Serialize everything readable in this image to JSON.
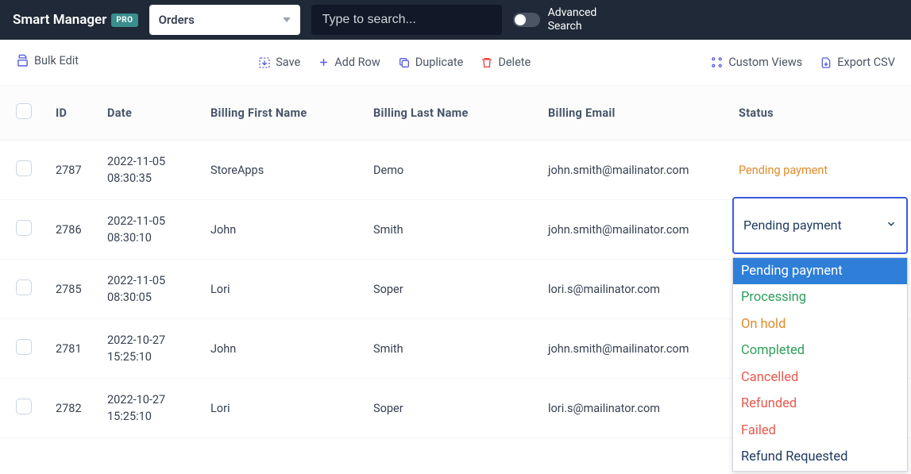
{
  "header": {
    "app_name": "Smart Manager",
    "pro_badge": "PRO",
    "entity": "Orders",
    "search_placeholder": "Type to search...",
    "advanced_label_l1": "Advanced",
    "advanced_label_l2": "Search"
  },
  "toolbar": {
    "bulk_edit": "Bulk Edit",
    "save": "Save",
    "add_row": "Add Row",
    "duplicate": "Duplicate",
    "delete": "Delete",
    "custom_views": "Custom Views",
    "export_csv": "Export CSV"
  },
  "columns": {
    "id": "ID",
    "date": "Date",
    "first": "Billing First Name",
    "last": "Billing Last Name",
    "email": "Billing Email",
    "status": "Status"
  },
  "rows": [
    {
      "id": "2787",
      "date_d": "2022-11-05",
      "date_t": "08:30:35",
      "first": "StoreApps",
      "last": "Demo",
      "email": "john.smith@mailinator.com",
      "status": "Pending payment",
      "status_style": "pending",
      "editing": false
    },
    {
      "id": "2786",
      "date_d": "2022-11-05",
      "date_t": "08:30:10",
      "first": "John",
      "last": "Smith",
      "email": "john.smith@mailinator.com",
      "status": "Pending payment",
      "status_style": "pending",
      "editing": true
    },
    {
      "id": "2785",
      "date_d": "2022-11-05",
      "date_t": "08:30:05",
      "first": "Lori",
      "last": "Soper",
      "email": "lori.s@mailinator.com",
      "status": "",
      "status_style": "",
      "editing": false
    },
    {
      "id": "2781",
      "date_d": "2022-10-27",
      "date_t": "15:25:10",
      "first": "John",
      "last": "Smith",
      "email": "john.smith@mailinator.com",
      "status": "",
      "status_style": "",
      "editing": false
    },
    {
      "id": "2782",
      "date_d": "2022-10-27",
      "date_t": "15:25:10",
      "first": "Lori",
      "last": "Soper",
      "email": "lori.s@mailinator.com",
      "status": "",
      "status_style": "",
      "editing": false
    }
  ],
  "status_dropdown": {
    "selected": "Pending payment",
    "options": [
      {
        "label": "Pending payment",
        "cls": "sel"
      },
      {
        "label": "Processing",
        "cls": "green"
      },
      {
        "label": "On hold",
        "cls": "orange"
      },
      {
        "label": "Completed",
        "cls": "green"
      },
      {
        "label": "Cancelled",
        "cls": "red"
      },
      {
        "label": "Refunded",
        "cls": "red"
      },
      {
        "label": "Failed",
        "cls": "red"
      },
      {
        "label": "Refund Requested",
        "cls": "navy"
      }
    ]
  }
}
